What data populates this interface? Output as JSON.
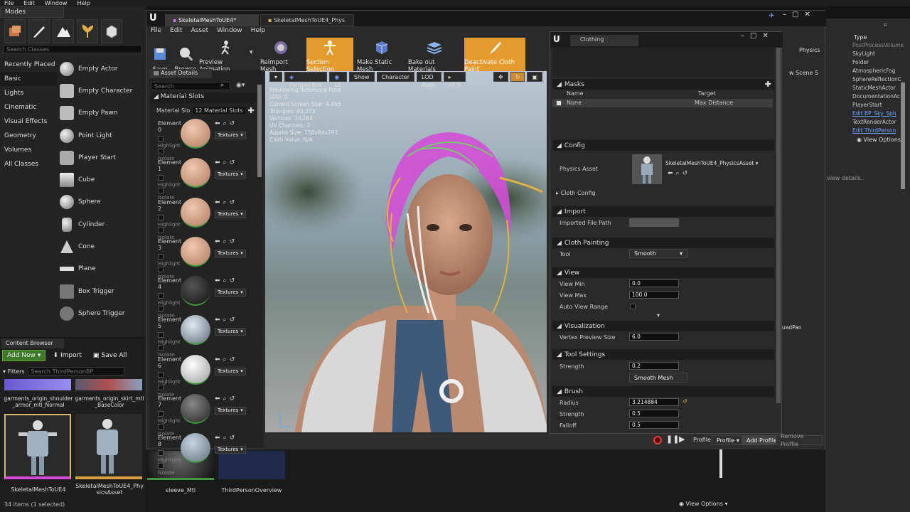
{
  "menu": [
    "File",
    "Edit",
    "Window",
    "Help"
  ],
  "modes": {
    "tab": "Modes",
    "search_placeholder": "Search Classes",
    "categories": [
      "Recently Placed",
      "Basic",
      "Lights",
      "Cinematic",
      "Visual Effects",
      "Geometry",
      "Volumes",
      "All Classes"
    ],
    "actors": [
      "Empty Actor",
      "Empty Character",
      "Empty Pawn",
      "Point Light",
      "Player Start",
      "Cube",
      "Sphere",
      "Cylinder",
      "Cone",
      "Plane",
      "Box Trigger",
      "Sphere Trigger"
    ]
  },
  "content_browser": {
    "tab": "Content Browser",
    "add_new": "Add New",
    "import": "Import",
    "save_all": "Save All",
    "filters": "Filters",
    "search_placeholder": "Search ThirdPersonBP",
    "top_items": [
      "garments_origin_shoulder_armor_mtl_Normal",
      "garments_origin_skirt_mtl_BaseColor"
    ],
    "items": [
      "SkeletalMeshToUE4",
      "SkeletalMeshToUE4_PhysicsAsset",
      "sleeve_Mtl",
      "ThirdPersonOverview"
    ],
    "status": "34 items (1 selected)",
    "view_options": "View Options"
  },
  "editor": {
    "tabs": [
      "SkeletalMeshToUE4*",
      "SkeletalMeshToUE4_Phys"
    ],
    "menu": [
      "File",
      "Edit",
      "Asset",
      "Window",
      "Help"
    ],
    "toolbar": [
      "Save",
      "Browse",
      "Preview Animation",
      "Reimport Mesh",
      "Section Selection",
      "Make Static Mesh",
      "Bake out Materials",
      "Deactivate Cloth Paint"
    ]
  },
  "asset_details": {
    "tab": "Asset Details",
    "search_placeholder": "Search",
    "section": "Material Slots",
    "slots_label": "Material Slo",
    "slots_count": "12 Material Slots",
    "elements": [
      "Element 0",
      "Element 1",
      "Element 2",
      "Element 3",
      "Element 4",
      "Element 5",
      "Element 6",
      "Element 7",
      "Element 8"
    ],
    "highlight": "Highlight",
    "isolate": "Isolate",
    "textures": "Textures"
  },
  "viewport": {
    "perspective": "Perspective",
    "lit": "Lit",
    "show": "Show",
    "character": "Character",
    "lod": "LOD Auto",
    "speed": "x1.0",
    "stats": [
      "Previewing Reference Pose",
      "LOD: 0",
      "Current Screen Size: 4.465",
      "Triangles: 45,273",
      "Vertices: 33,264",
      "UV Channels: 2",
      "Approx Size: 156x84x293",
      "Cloth Value: N/A"
    ]
  },
  "clothing": {
    "tab": "Clothing",
    "masks": {
      "title": "Masks",
      "col_name": "Name",
      "col_target": "Target",
      "row_name": "None",
      "row_target": "Max Distance"
    },
    "config": {
      "title": "Config",
      "physics_asset": "Physics Asset",
      "physics_value": "SkeletalMeshToUE4_PhysicsAsset",
      "cloth_config": "Cloth Config"
    },
    "import": {
      "title": "Import",
      "path": "Imported File Path"
    },
    "painting": {
      "title": "Cloth Painting",
      "tool": "Tool",
      "tool_value": "Smooth"
    },
    "view": {
      "title": "View",
      "min": "View Min",
      "min_v": "0.0",
      "max": "View Max",
      "max_v": "100.0",
      "auto": "Auto View Range"
    },
    "vis": {
      "title": "Visualization",
      "size": "Vertex Preview Size",
      "size_v": "6.0"
    },
    "tool_settings": {
      "title": "Tool Settings",
      "strength": "Strength",
      "strength_v": "0.2",
      "smooth": "Smooth Mesh"
    },
    "brush": {
      "title": "Brush",
      "radius": "Radius",
      "radius_v": "3.214884",
      "strength": "Strength",
      "strength_v": "0.5",
      "falloff": "Falloff",
      "falloff_v": "0.5"
    }
  },
  "bottom": {
    "profile": "Profile",
    "add_profile": "Add Profile",
    "remove_profile": "Remove Profile"
  },
  "right": {
    "physics": "Physics",
    "type": "Type",
    "items": [
      "PostProcessVolume",
      "SkyLight",
      "Folder",
      "AtmosphericFog",
      "SphereReflectionC",
      "StaticMeshActor",
      "DocumentationAc",
      "PlayerStart",
      "Edit BP_Sky_Sph",
      "TextRenderActor",
      "Edit ThirdPerson"
    ],
    "view_options": "View Options",
    "view_details": "view details.",
    "scene": "w Scene S",
    "quadpan": "uadPan"
  }
}
